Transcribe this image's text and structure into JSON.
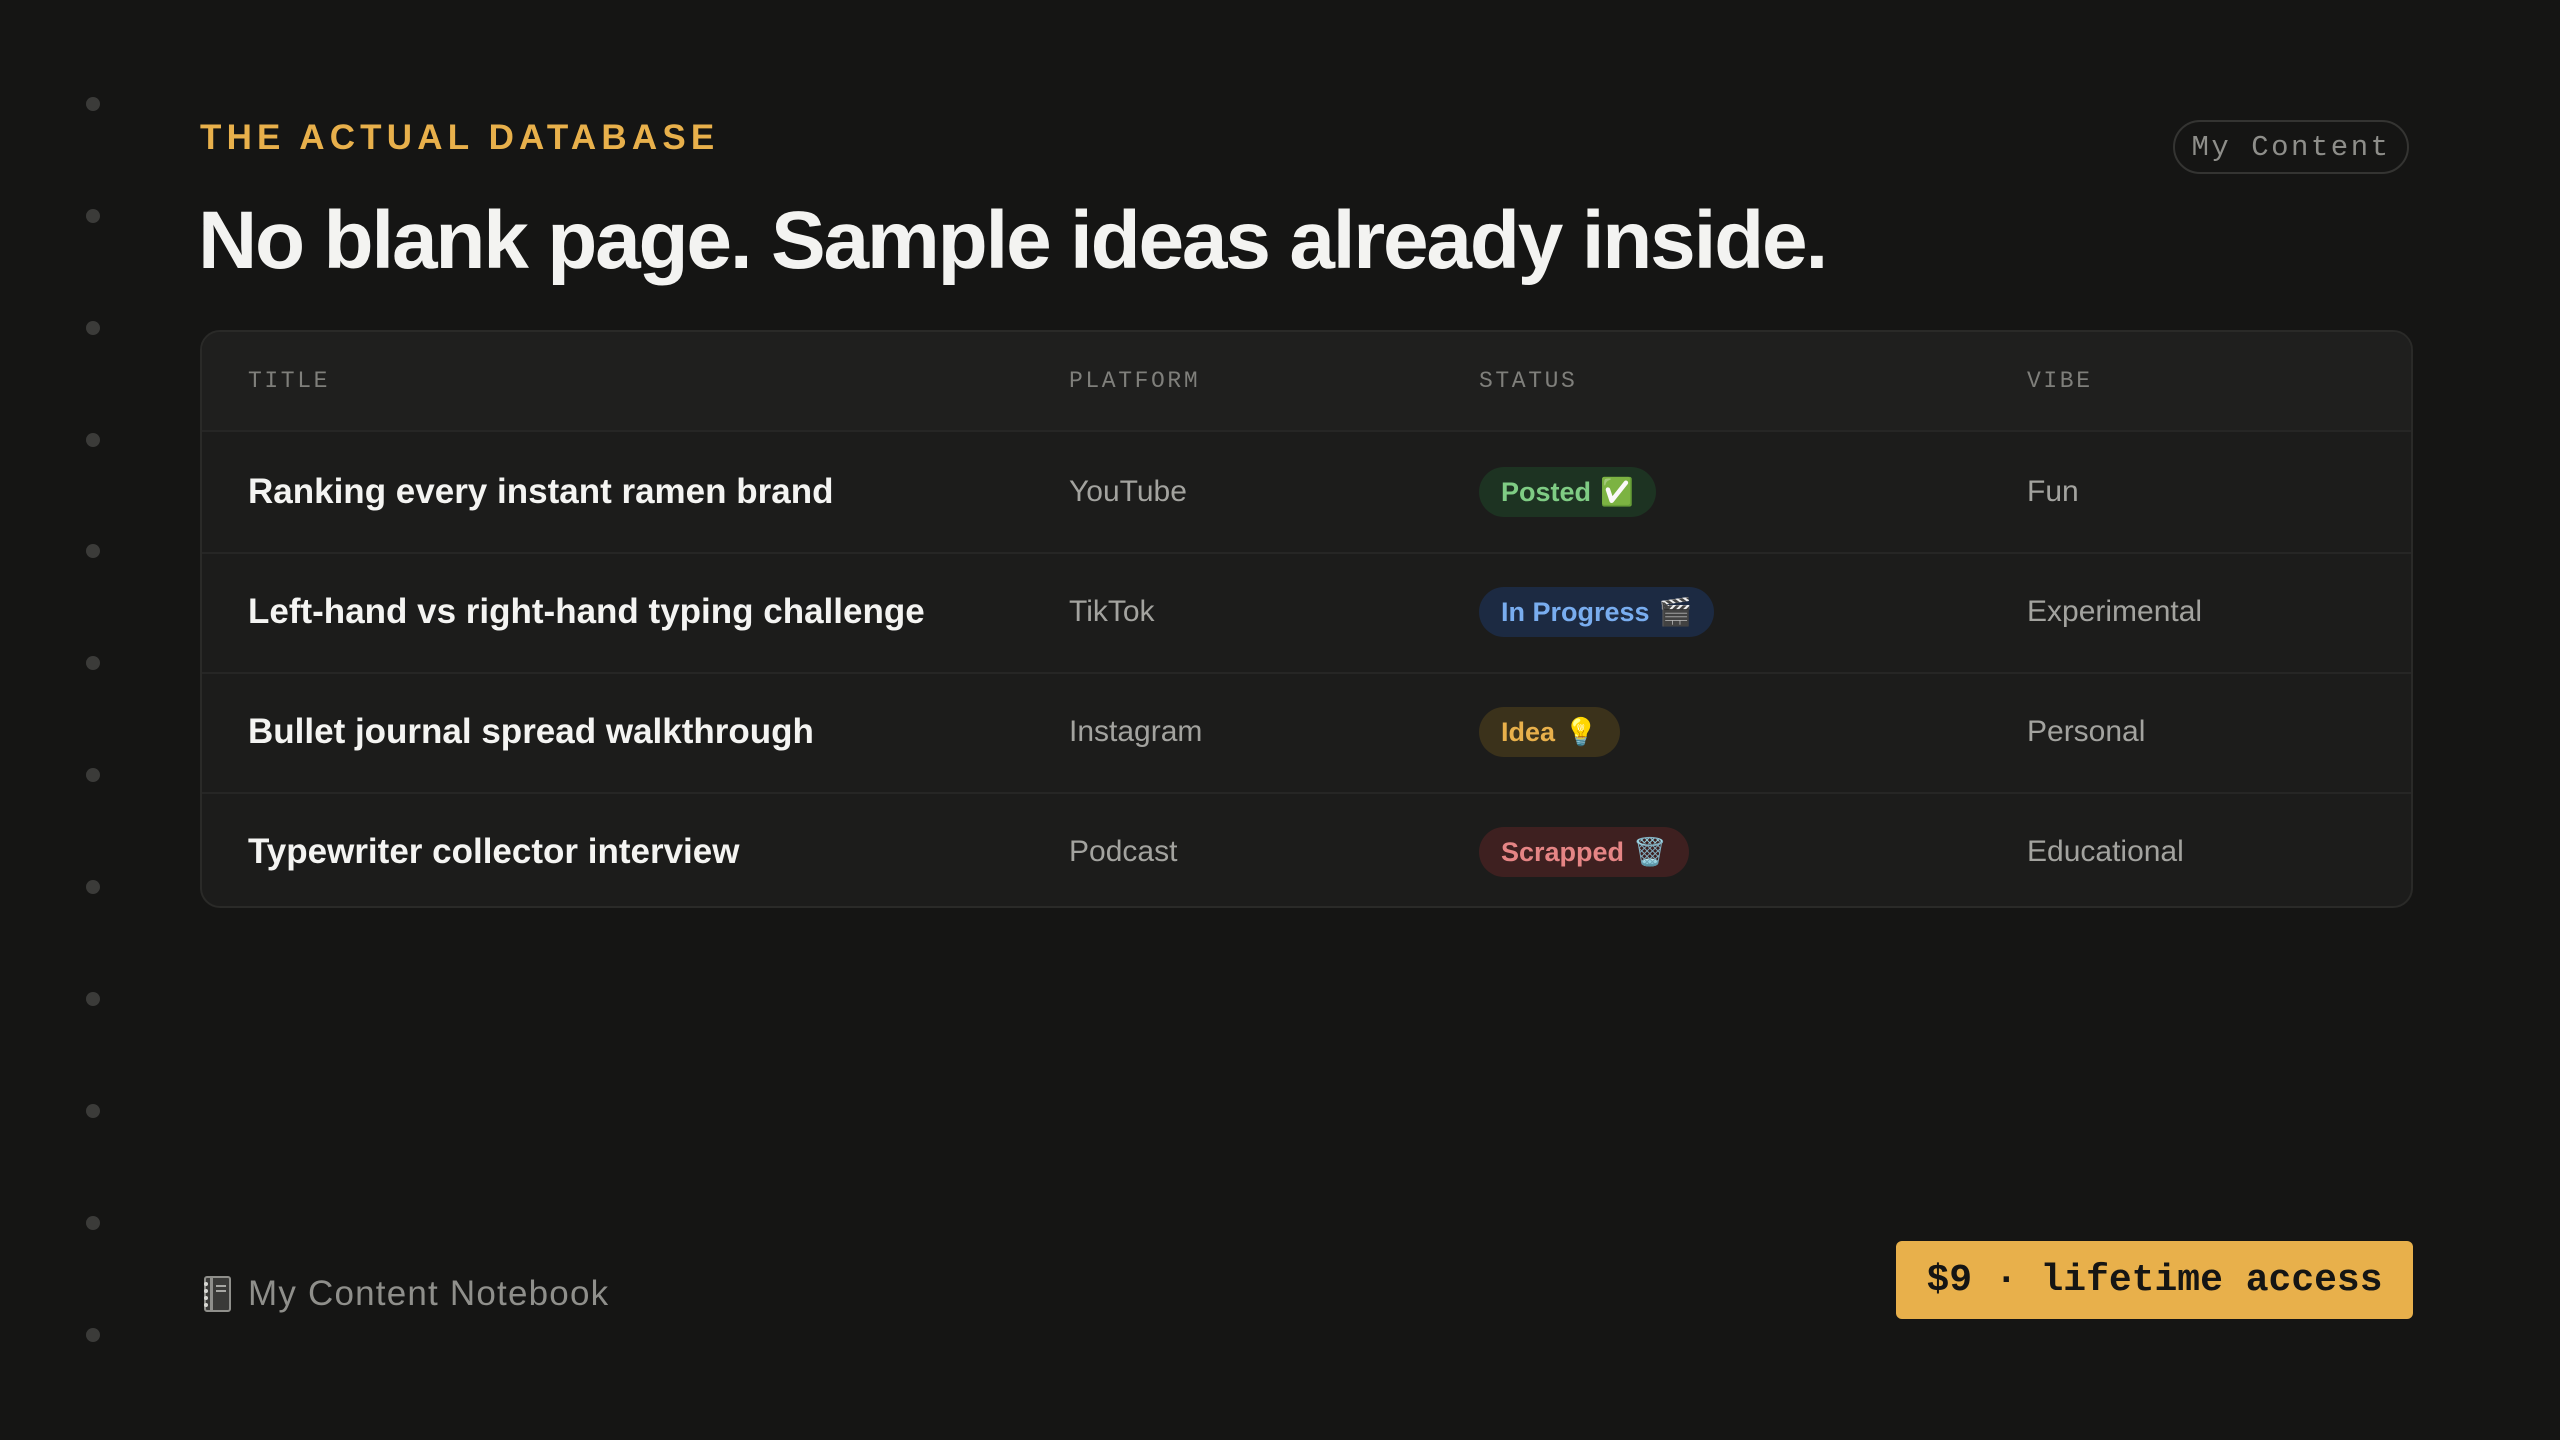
{
  "section": {
    "eyebrow": "THE ACTUAL DATABASE",
    "headline": "No blank page. Sample ideas already inside.",
    "tag": "My Content"
  },
  "table": {
    "headers": [
      "TITLE",
      "PLATFORM",
      "STATUS",
      "VIBE"
    ],
    "rows": [
      {
        "title": "Ranking every instant ramen brand",
        "platform": "YouTube",
        "status": "Posted",
        "status_emoji": "✅",
        "vibe": "Fun"
      },
      {
        "title": "Left-hand vs right-hand typing challenge",
        "platform": "TikTok",
        "status": "In Progress",
        "status_emoji": "🎬",
        "vibe": "Experimental"
      },
      {
        "title": "Bullet journal spread walkthrough",
        "platform": "Instagram",
        "status": "Idea",
        "status_emoji": "💡",
        "vibe": "Personal"
      },
      {
        "title": "Typewriter collector interview",
        "platform": "Podcast",
        "status": "Scrapped",
        "status_emoji": "🗑️",
        "vibe": "Educational"
      }
    ]
  },
  "status_colors": {
    "Posted": {
      "bg": "#1d3322",
      "fg": "#7fcc84"
    },
    "In Progress": {
      "bg": "#1c2a42",
      "fg": "#79adef"
    },
    "Idea": {
      "bg": "#3b321b",
      "fg": "#e8b04b"
    },
    "Scrapped": {
      "bg": "#3e2020",
      "fg": "#e58585"
    }
  },
  "footer": {
    "brand_icon": "notebook-icon",
    "brand": "My Content Notebook",
    "cta": "$9 · lifetime access"
  },
  "colors": {
    "background": "#151514",
    "accent": "#e8b04b",
    "card": "#1c1c1b"
  }
}
